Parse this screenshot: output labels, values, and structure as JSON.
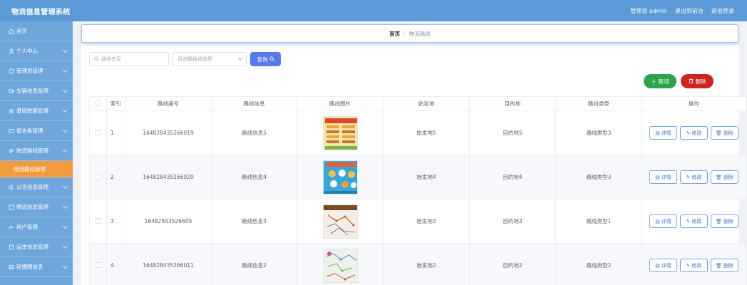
{
  "header": {
    "app_title": "物流信息管理系统",
    "admin_label": "管理员 admin",
    "back_label": "退出到前台",
    "logout_label": "退出登录"
  },
  "sidebar": {
    "items": [
      {
        "label": "首页",
        "icon": "home-icon"
      },
      {
        "label": "个人中心",
        "icon": "user-icon"
      },
      {
        "label": "管理员管理",
        "icon": "admin-icon"
      },
      {
        "label": "车辆信息管理",
        "icon": "truck-icon"
      },
      {
        "label": "基础数据管理",
        "icon": "list-icon"
      },
      {
        "label": "留言板管理",
        "icon": "message-icon"
      },
      {
        "label": "物流路线管理",
        "icon": "route-icon"
      },
      {
        "label": "物流路线管理",
        "icon": "",
        "active": true
      },
      {
        "label": "公告信息管理",
        "icon": "notice-icon"
      },
      {
        "label": "物流信息管理",
        "icon": "logistics-icon"
      },
      {
        "label": "用户管理",
        "icon": "users-icon"
      },
      {
        "label": "运单信息管理",
        "icon": "waybill-icon"
      },
      {
        "label": "轮播图信息",
        "icon": "image-icon"
      }
    ],
    "bg_color": "#6fa7dd",
    "active_color": "#f19a3e"
  },
  "breadcrumb": {
    "home": "首页",
    "separator": "/",
    "current": "物流路线"
  },
  "search": {
    "route_info_placeholder": "路线信息",
    "route_type_placeholder": "请选择路线类型",
    "query_label": "查询"
  },
  "toolbar": {
    "add_label": "新增",
    "delete_label": "删除",
    "add_color": "#2fa34b",
    "delete_color": "#cc2424"
  },
  "table": {
    "headers": [
      "索引",
      "路线编号",
      "路线信息",
      "路线图片",
      "始发地",
      "目的地",
      "路线类型",
      "操作"
    ],
    "rows": [
      {
        "index": "1",
        "code": "164828435266019",
        "info": "路线信息5",
        "origin": "始发地5",
        "dest": "目的地5",
        "type": "路线类型3"
      },
      {
        "index": "2",
        "code": "164828435266020",
        "info": "路线信息4",
        "origin": "始发地4",
        "dest": "目的地4",
        "type": "路线类型3"
      },
      {
        "index": "3",
        "code": "16482843526605",
        "info": "路线信息3",
        "origin": "始发地3",
        "dest": "目的地3",
        "type": "路线类型1"
      },
      {
        "index": "4",
        "code": "164828435266011",
        "info": "路线信息2",
        "origin": "始发地2",
        "dest": "目的地2",
        "type": "路线类型2"
      }
    ],
    "action_labels": {
      "detail": "详情",
      "edit": "修改",
      "delete": "删除"
    }
  }
}
